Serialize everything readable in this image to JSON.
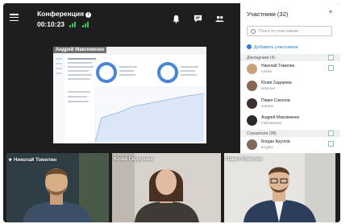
{
  "header": {
    "title": "Конференция",
    "timer": "00:10:23"
  },
  "share": {
    "presenter": "Андрей Максименко"
  },
  "sidebar": {
    "title": "Участники (32)",
    "search_placeholder": "Поиск по участникам",
    "add_label": "Добавить участников",
    "speakers_section": "Докладчики (4)",
    "speakers": [
      {
        "name": "Николай Томилин",
        "login": "tomilin"
      },
      {
        "name": "Юлия Сидорова",
        "login": "sidorova"
      },
      {
        "name": "Павел Соколов",
        "login": "sokolov"
      },
      {
        "name": "Андрей Максименко",
        "login": "maksimenko"
      }
    ],
    "listeners_section": "Слушатели (28)",
    "listeners": [
      {
        "name": "Богдан Круглов",
        "login": "kruglov"
      }
    ]
  },
  "tiles": [
    {
      "label": "★ Николай Томилин"
    },
    {
      "label": "Юлия Сидорова"
    },
    {
      "label": "Павел Соколов"
    }
  ],
  "colors": {
    "accent": "#2a7bd8",
    "signal": "#37c05a",
    "background": "#1e1e1e"
  }
}
